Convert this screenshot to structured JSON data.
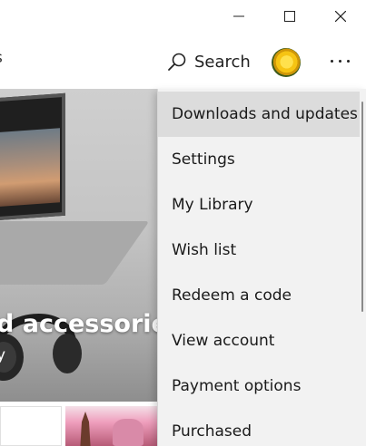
{
  "window": {
    "controls": {
      "minimize_icon": "minimize-icon",
      "maximize_icon": "maximize-icon",
      "close_icon": "close-icon"
    }
  },
  "toolbar": {
    "search_label": "Search",
    "search_icon": "search-icon",
    "more_icon": "more-icon",
    "nav_partial": "s"
  },
  "hero": {
    "title_partial": "d accessories",
    "subtitle_partial": "y"
  },
  "menu": {
    "items": [
      {
        "label": "Downloads and updates",
        "active": true
      },
      {
        "label": "Settings"
      },
      {
        "label": "My Library"
      },
      {
        "label": "Wish list"
      },
      {
        "label": "Redeem a code"
      },
      {
        "label": "View account"
      },
      {
        "label": "Payment options"
      },
      {
        "label": "Purchased"
      }
    ]
  },
  "colors": {
    "menu_background": "#f2f2f2",
    "menu_hover": "#dcdcdc",
    "text": "#1a1a1a"
  }
}
